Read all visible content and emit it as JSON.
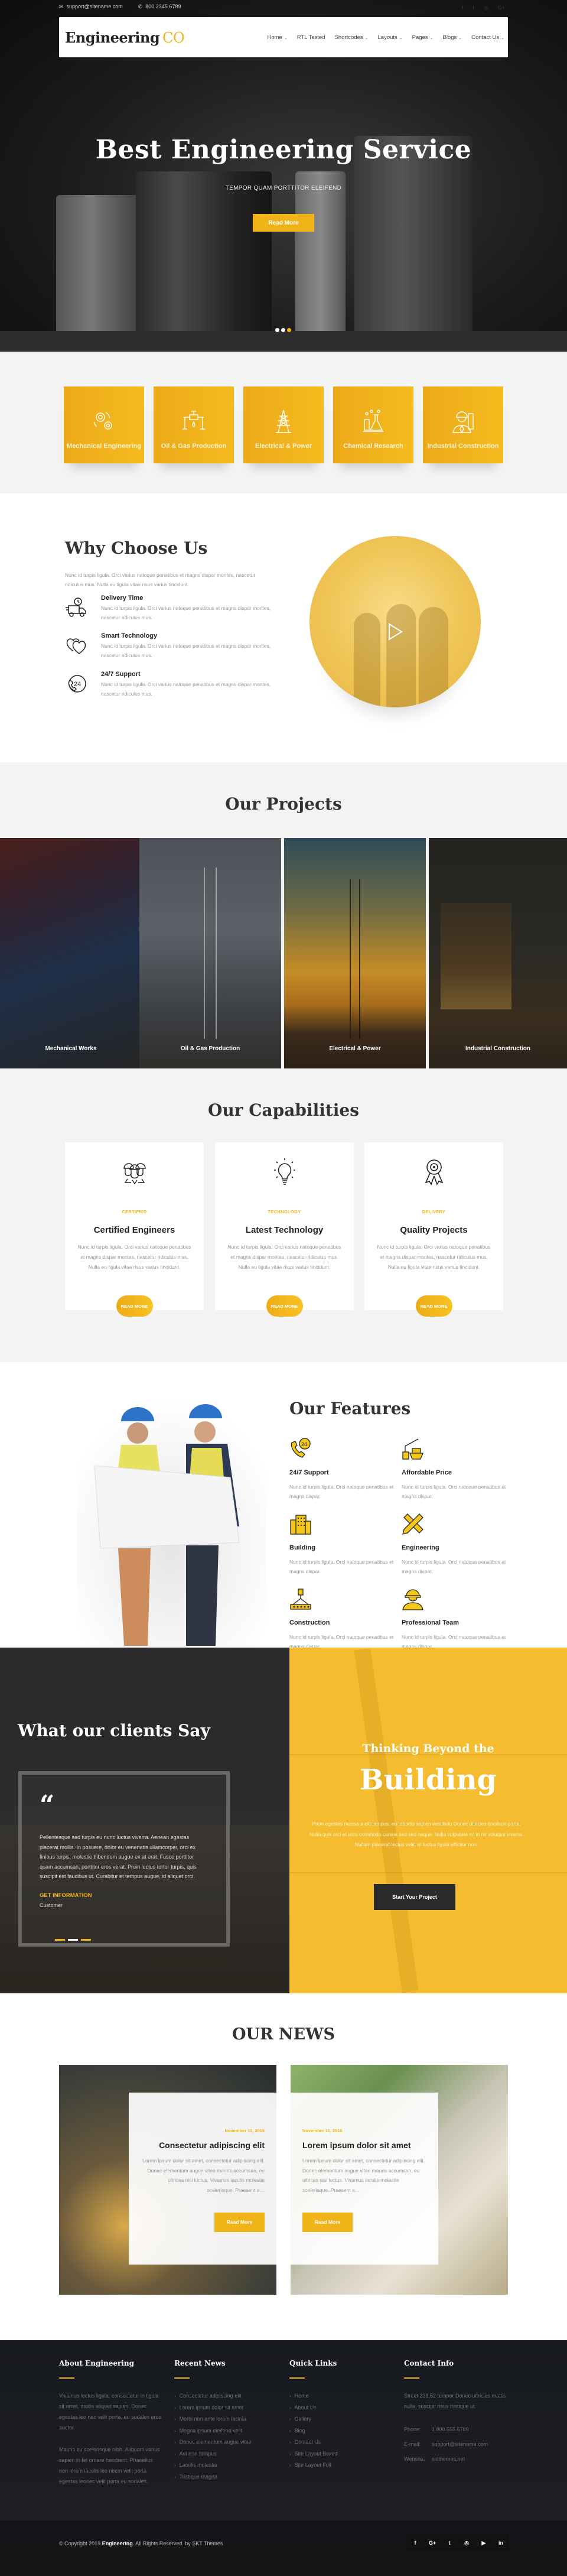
{
  "colors": {
    "accent": "#f1b418",
    "dark": "#2b2b2b",
    "footer_bg": "#1b1d21"
  },
  "topbar": {
    "email": "support@sitename.com",
    "phone": "800 2345 6789",
    "email_icon": "envelope-icon",
    "phone_icon": "phone-icon",
    "social": [
      "facebook-icon",
      "twitter-icon",
      "instagram-icon",
      "google-plus-icon"
    ]
  },
  "nav": {
    "logo_main": "Engineering",
    "logo_accent": "CO",
    "items": [
      {
        "label": "Home",
        "dropdown": true
      },
      {
        "label": "RTL Tested",
        "dropdown": false
      },
      {
        "label": "Shortcodes",
        "dropdown": true
      },
      {
        "label": "Layouts",
        "dropdown": true
      },
      {
        "label": "Pages",
        "dropdown": true
      },
      {
        "label": "Blogs",
        "dropdown": true
      },
      {
        "label": "Contact Us",
        "dropdown": true
      }
    ]
  },
  "hero": {
    "title": "Best Engineering Service",
    "subtitle": "TEMPOR QUAM PORTTITOR ELEIFEND",
    "button": "Read More",
    "slides": 3,
    "active_slide": 3
  },
  "services": [
    {
      "label": "Mechanical Engineering",
      "icon": "gears-icon"
    },
    {
      "label": "Oil & Gas Production",
      "icon": "pipeline-icon"
    },
    {
      "label": "Electrical & Power",
      "icon": "power-tower-icon"
    },
    {
      "label": "Chemical Research",
      "icon": "flask-icon"
    },
    {
      "label": "Industrial Construction",
      "icon": "engineer-icon"
    }
  ],
  "why": {
    "title": "Why Choose Us",
    "intro": "Nunc id turpis ligula. Orci varius natoque penatibus et magns dispar montes, nascetur ridiculus mus. Nulla eu ligula vitae risus varius tincidunt.",
    "items": [
      {
        "title": "Delivery Time",
        "text": "Nunc id turpis ligula. Orci varius natoque penatibus et magns dispar montes, nascetur ridiculus mus.",
        "icon": "delivery-truck-icon"
      },
      {
        "title": "Smart Technology",
        "text": "Nunc id turpis ligula. Orci varius natoque penatibus et magns dispar montes, nascetur ridiculus mus.",
        "icon": "hearts-icon"
      },
      {
        "title": "24/7 Support",
        "text": "Nunc id turpis ligula. Orci varius natoque penatibus et magns dispar montes, nascetur ridiculus mus.",
        "icon": "phone-24-icon"
      }
    ],
    "video_icon": "play-icon"
  },
  "projects": {
    "title": "Our Projects",
    "items": [
      "Mechanical Works",
      "Oil & Gas Production",
      "Electrical & Power",
      "Industrial Construction"
    ]
  },
  "capabilities": {
    "title": "Our Capabilities",
    "items": [
      {
        "tag": "CERTIFIED",
        "title": "Certified Engineers",
        "text": "Nunc id turpis ligula. Orci varius natoque penatibus et magns dispar montes, nascetur ridiculus mus. Nulla eu ligula vitae risus varius tincidunt.",
        "button": "READ MORE",
        "icon": "engineers-team-icon"
      },
      {
        "tag": "TECHNOLOGY",
        "title": "Latest Technology",
        "text": "Nunc id turpis ligula. Orci varius natoque penatibus et magns dispar montes, nascetur ridiculus mus. Nulla eu ligula vitae risus varius tincidunt.",
        "button": "READ MORE",
        "icon": "lightbulb-icon"
      },
      {
        "tag": "DELIVERY",
        "title": "Quality Projects",
        "text": "Nunc id turpis ligula. Orci varius natoque penatibus et magns dispar montes, nascetur ridiculus mus. Nulla eu ligula vitae risus varius tincidunt.",
        "button": "READ MORE",
        "icon": "award-ribbon-icon"
      }
    ]
  },
  "features": {
    "title": "Our Features",
    "items": [
      {
        "title": "24/7 Support",
        "text": "Nunc id turpis ligula. Orci natoque penatibus et magns dispar.",
        "icon": "support-24-icon"
      },
      {
        "title": "Affordable Price",
        "text": "Nunc id turpis ligula. Orci natoque penatibus et magns dispar.",
        "icon": "crane-ship-icon"
      },
      {
        "title": "Building",
        "text": "Nunc id turpis ligula. Orci natoque penatibus et magns dispar.",
        "icon": "buildings-icon"
      },
      {
        "title": "Engineering",
        "text": "Nunc id turpis ligula. Orci natoque penatibus et magns dispar.",
        "icon": "ruler-pencil-icon"
      },
      {
        "title": "Construction",
        "text": "Nunc id turpis ligula. Orci natoque penatibus et magns dispar.",
        "icon": "crane-beam-icon"
      },
      {
        "title": "Professional Team",
        "text": "Nunc id turpis ligula. Orci natoque penatibus et magns dispar.",
        "icon": "worker-icon"
      }
    ]
  },
  "testimonial": {
    "title": "What our clients Say",
    "quote": "Pellentesque sed turpis eu nunc luctus viverra. Aenean egestas placerat mollis. In posuere, dolor eu venenatis ullamcorper, orci ex finibus turpis, molestie bibendum augue ex at erat. Fusce porttitor quam accumsan, porttitor eros verat. Proin luctus tortor turpis, quis suscipit est faucibus ut. Curabitur et tempus augue, id aliquet orci.",
    "name": "GET INFORMATION",
    "role": "Customer",
    "slides": 3,
    "active_slide": 2
  },
  "cta": {
    "title_small": "Thinking Beyond the",
    "title_big": "Building",
    "text": "Proin egestas massa a elit tempus, eu lobortis sapien vestibulu Donec ultricies tincidunt porta. Nulla quis orci et arcu commodo cursus sed sed neque. Nulla vulputate mi in mi volutpat viverra. Nullam placerat lectus velit, et luctus ligula efficitur non.",
    "button": "Start Your Project"
  },
  "news": {
    "title": "OUR NEWS",
    "items": [
      {
        "date": "November 11, 2016",
        "title": "Consectetur adipiscing elit",
        "text": "Lorem ipsum dolor sit amet, consectetur adipiscing elit. Donec elementum augue vitae mauris accumsan, eu ultrices nisi luctus. Vivamus iaculis molestie scelerisque. Praesent a…",
        "button": "Read More"
      },
      {
        "date": "November 11, 2016",
        "title": "Lorem ipsum dolor sit amet",
        "text": "Lorem ipsum dolor sit amet, consectetur adipiscing elit. Donec elementum augue vitae mauris accumsan, eu ultrices nisi luctus. Vivamus iaculis molestie scelerisque. Praesent a…",
        "button": "Read More"
      }
    ]
  },
  "footer": {
    "about": {
      "title": "About Engineering",
      "p1": "Vivamus lectus ligula, consectetur in ligula sit amet, mollis aliquet sapien. Donec egestas leo nec velit porta, eu sodales eros auctor.",
      "p2": "Mauris eu scelerisque nibh. Aliquam varius sapien in fel ornare hendrerit. Phasellus non lorem iaculis leo necm velit porta egestas leonec velit porta eu sodales."
    },
    "recent": {
      "title": "Recent News",
      "items": [
        "Consectetur adipiscing elit",
        "Lorem ipsum dolor sit amet",
        "Morbi non ante lorem lacinia",
        "Magna ipsum eleifend velit",
        "Donec elementum augue vitae",
        "Aenean tempus",
        "Laculis molestie",
        "Tristique magna"
      ]
    },
    "links": {
      "title": "Quick Links",
      "items": [
        "Home",
        "About Us",
        "Gallery",
        "Blog",
        "Contact Us",
        "Site Layout Boxed",
        "Site Layout Full"
      ]
    },
    "contact": {
      "title": "Contact Info",
      "address": "Street 238,52 tempor Donec ultricies mattis nulla, suscipit risus tristique ut.",
      "phone_label": "Phone:",
      "phone": "1.800.555.6789",
      "email_label": "E-mail:",
      "email": "support@sitename.com",
      "website_label": "Website:",
      "website": "sktthemes.net"
    },
    "copyright_pre": "© Copyright 2019",
    "copyright_brand": "Engineering",
    "copyright_post": ". All Rights Reserved. by SKT Themes",
    "social": [
      {
        "icon": "facebook-icon",
        "glyph": "f"
      },
      {
        "icon": "google-plus-icon",
        "glyph": "G+"
      },
      {
        "icon": "twitter-icon",
        "glyph": "t"
      },
      {
        "icon": "instagram-icon",
        "glyph": "◎"
      },
      {
        "icon": "youtube-icon",
        "glyph": "▶"
      },
      {
        "icon": "linkedin-icon",
        "glyph": "in"
      }
    ]
  }
}
